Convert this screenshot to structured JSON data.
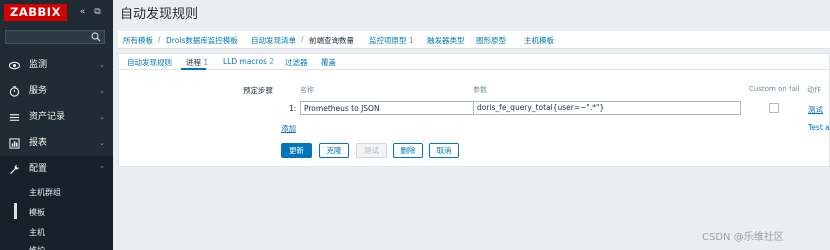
{
  "sidebar": {
    "logo": "ZABBIX",
    "collapse_glyph": "«",
    "kiosk_glyph": "⧉",
    "search": {
      "value": "",
      "placeholder": ""
    },
    "menu": [
      {
        "label": "监测",
        "icon": "eye-icon"
      },
      {
        "label": "服务",
        "icon": "clock-icon"
      },
      {
        "label": "资产记录",
        "icon": "list-icon"
      },
      {
        "label": "报表",
        "icon": "chart-icon"
      },
      {
        "label": "配置",
        "icon": "wrench-icon"
      }
    ],
    "submenu": [
      "主机群组",
      "模板",
      "主机",
      "维护"
    ]
  },
  "page": {
    "title": "自动发现规则"
  },
  "breadcrumb": {
    "all_templates": "所有模板",
    "template": "Drois数据库监控模板",
    "discovery_list": "自动发现清单",
    "current": "前端查询数量",
    "item_prototypes": "监控项原型",
    "item_prototypes_count": "1",
    "trigger_prototypes": "触发器类型",
    "graph_prototypes": "图形原型",
    "host_prototypes": "主机模板"
  },
  "tabs": {
    "discovery_rule": "自动发现规则",
    "preprocessing": "进程",
    "preprocessing_count": "1",
    "lld_macros": "LLD macros",
    "lld_macros_count": "2",
    "filters": "过滤器",
    "overrides": "覆盖"
  },
  "form": {
    "steps_label": "预定步骤",
    "col_name": "名称",
    "col_params": "参数",
    "col_custom_on_fail": "Custom on fail",
    "col_actions": "动作",
    "row_num": "1:",
    "step_type": "Prometheus to JSON",
    "param_value": "doris_fe_query_total{user=~\".*\"}",
    "test_link": "测试",
    "test_all_link": "Test a",
    "add_link": "添加"
  },
  "buttons": {
    "update": "更新",
    "clone": "克隆",
    "test": "测试",
    "delete": "删除",
    "cancel": "取消"
  },
  "watermark": "CSDN @乐维社区",
  "colors": {
    "sidebar": "#1f2c33",
    "accent": "#0275b8",
    "logo": "#d40000"
  }
}
